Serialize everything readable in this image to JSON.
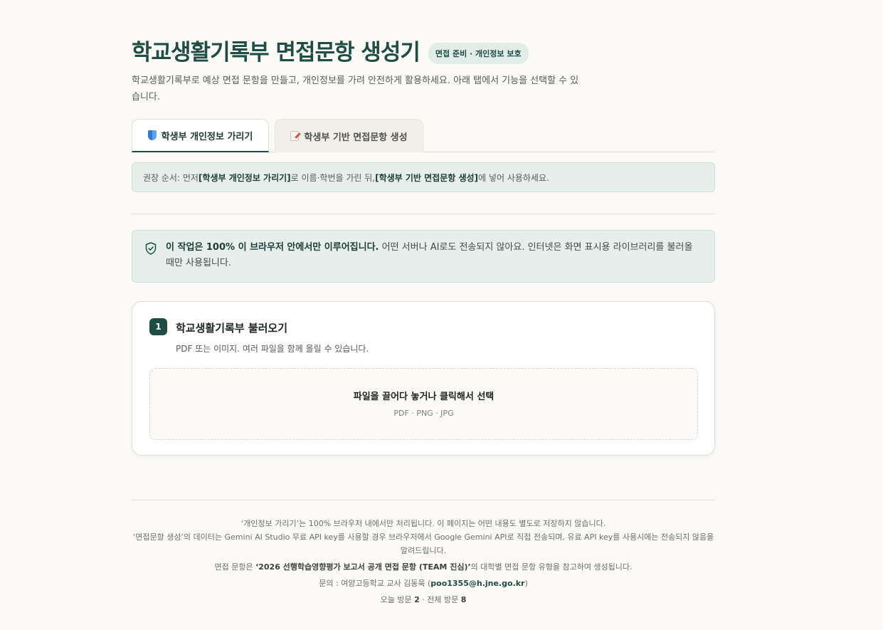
{
  "header": {
    "title": "학교생활기록부 면접문항 생성기",
    "badge": "면접 준비 · 개인정보 보호",
    "subtitle": "학교생활기록부로 예상 면접 문항을 만들고, 개인정보를 가려 안전하게 활용하세요. 아래 탭에서 기능을 선택할 수 있습니다."
  },
  "tabs": [
    {
      "label": "학생부 개인정보 가리기",
      "icon": "shield-icon",
      "active": true
    },
    {
      "label": "학생부 기반 면접문항 생성",
      "icon": "memo-icon",
      "active": false
    }
  ],
  "notice": {
    "prefix": "권장 순서: 먼저 ",
    "step1": "[학생부 개인정보 가리기]",
    "middle": "로 이름·학번을 가린 뒤, ",
    "step2": "[학생부 기반 면접문항 생성]",
    "suffix": "에 넣어 사용하세요."
  },
  "privacy": {
    "bold": "이 작업은 100% 이 브라우저 안에서만 이루어집니다.",
    "text": " 어떤 서버나 AI로도 전송되지 않아요. 인터넷은 화면 표시용 라이브러리를 불러올 때만 사용됩니다."
  },
  "upload": {
    "step_number": "1",
    "title": "학교생활기록부 불러오기",
    "description": "PDF 또는 이미지. 여러 파일을 함께 올릴 수 있습니다.",
    "drop_title": "파일을 끌어다 놓거나 클릭해서 선택",
    "drop_formats": "PDF · PNG · JPG"
  },
  "footer": {
    "line1": "‘개인정보 가리기’는 100% 브라우저 내에서만 처리됩니다. 이 페이지는 어떤 내용도 별도로 저장하지 않습니다.",
    "line2": "‘면접문항 생성’의 데이터는 Gemini AI Studio 무료 API key를 사용할 경우 브라우저에서 Google Gemini API로 직접 전송되며, 유료 API key를 사용시에는 전송되지 않음을 알려드립니다.",
    "line3_prefix": "면접 문항은 ",
    "line3_bold": "‘2026 선행학습영향평가 보고서 공개 면접 문항 (TEAM 진심)’",
    "line3_suffix": "의 대학별 면접 문항 유형을 참고하여 생성됩니다.",
    "contact_prefix": "문의 : 여양고등학교 교사 김동욱 (",
    "contact_email": "poo1355@h.jne.go.kr",
    "contact_suffix": ")",
    "visits_today_label": "오늘 방문 ",
    "visits_today": "2",
    "visits_sep": " · 전체 방문 ",
    "visits_total": "8"
  },
  "colors": {
    "accent": "#1e4d44",
    "background": "#fbfaf7",
    "notice_bg": "#e6efec"
  }
}
